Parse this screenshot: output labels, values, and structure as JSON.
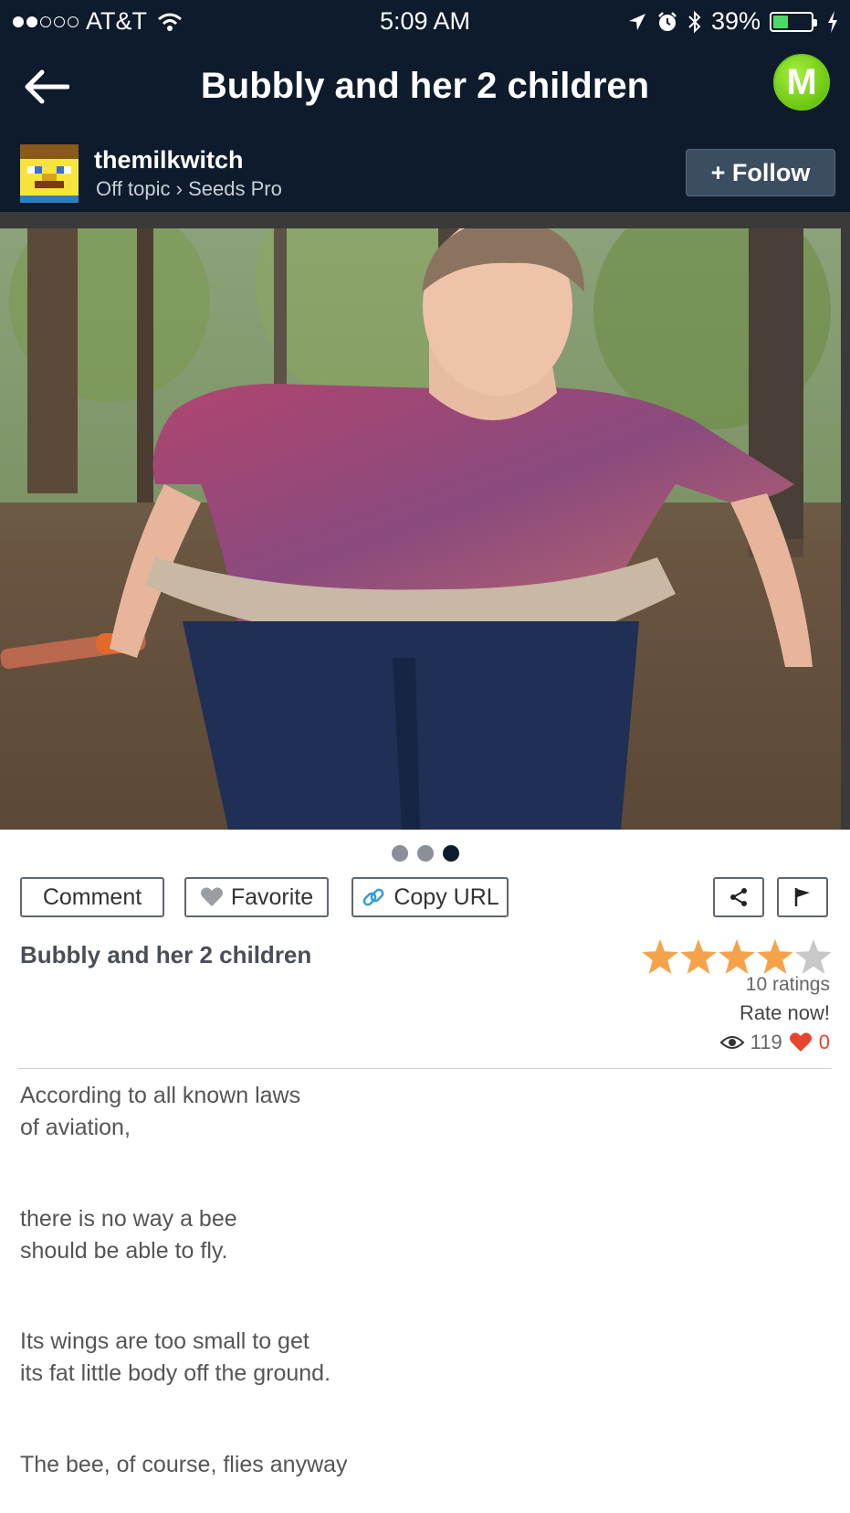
{
  "status_bar": {
    "carrier": "AT&T",
    "time": "5:09 AM",
    "battery_percent": "39%",
    "battery_level": 0.39,
    "signal_bars_filled": 2,
    "signal_bars_total": 5
  },
  "nav": {
    "title": "Bubbly and her 2 children",
    "badge_letter": "M"
  },
  "author": {
    "name": "themilkwitch",
    "category": "Off topic",
    "subcategory": "Seeds Pro",
    "separator": "›",
    "follow_label": "+ Follow"
  },
  "gallery": {
    "page_count": 3,
    "active_page": 3
  },
  "actions": {
    "comment": "Comment",
    "favorite": "Favorite",
    "copy_url": "Copy URL"
  },
  "post": {
    "title": "Bubbly and her 2 children",
    "rating_stars": 4,
    "rating_max": 5,
    "ratings_count_text": "10 ratings",
    "rate_now": "Rate now!",
    "views": "119",
    "likes": "0",
    "body": [
      "According to all known laws\nof aviation,",
      "there is no way a bee\nshould be able to fly.",
      "Its wings are too small to get\nits fat little body off the ground.",
      "The bee, of course, flies anyway"
    ]
  },
  "colors": {
    "header_bg": "#0e1b2c",
    "star_filled": "#f5a34a",
    "star_empty": "#c8c8c8",
    "heart": "#e8442e",
    "badge_green": "#6fc81e"
  }
}
